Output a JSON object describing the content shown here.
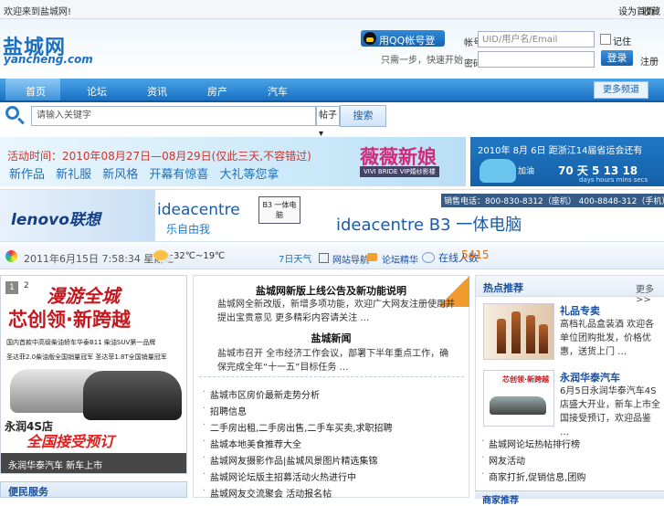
{
  "topbar": {
    "welcome": "欢迎来到盐城网!",
    "links": [
      "设为首页",
      "收藏"
    ]
  },
  "header": {
    "logo_text": "盐城网",
    "logo_sub": "yancheng.com",
    "qq_login": "用QQ帐号登录",
    "qq_note": "只需一步，快速开始",
    "uid_label": "帐号",
    "uid_placeholder": "UID/用户名/Email",
    "password_label": "密码",
    "remember_label": "记住",
    "login_button": "登录",
    "register_link": "注册"
  },
  "nav": {
    "items": [
      "首页",
      "论坛",
      "资讯",
      "房产",
      "汽车"
    ],
    "right_button": "更多频道"
  },
  "search": {
    "placeholder": "请输入关键字",
    "select_value": "帖子",
    "button": "搜索"
  },
  "banner_wedding": {
    "date_line": "活动时间：2010年08月27日—08月29日(仅此三天,不容错过)",
    "tagline": "新作品  新礼服  新风格  开幕有惊喜  大礼等您拿",
    "brand": "薇薇新娘",
    "brand_sub": "VIVI BRIDE  VIP婚纱影楼"
  },
  "banner_games": {
    "text": "2010年 8月 6日 距浙江14届省运会还有",
    "countdown": "70 天 5  13  18",
    "units": "days  hours  mins  secs",
    "cheer": "加油"
  },
  "banner_lenovo": {
    "logo": "lenovo联想",
    "ideacentre_1": "ideacentre",
    "ideacentre_sub": "乐自由我",
    "b3_box": "B3 一体电脑",
    "ideacentre_2": "ideacentre B3 一体电脑",
    "sales": "销售电话：800-830-8312（座机） 400-8848-312（手机）"
  },
  "infobar": {
    "datetime": "2011年6月15日 7:58:34 星期三",
    "weather": "32℃~19℃",
    "link_a": "7日天气",
    "link_b": "网站导航",
    "link_c": "论坛精华",
    "online_label": "在线人数",
    "online_count": "5415"
  },
  "slideshow": {
    "page_current": "1",
    "page_next": "2",
    "ad_title": "漫游全城",
    "ad_slogan": "芯创领·新跨越",
    "ad_line1": "国内首款中高级柴油轿车华泰B11  柴油SUV第一品牌",
    "ad_line2": "圣达菲2.0柴油版全国销量冠军  圣达菲1.8T全国销量冠军",
    "ad_shop": "永润4S店",
    "ad_call": "全国接受预订",
    "caption": "永润华泰汽车 新车上市"
  },
  "left_bottom_title": "便民服务",
  "middle": {
    "headline1": "盐城网新版上线公告及新功能说明",
    "para1": "盐城网全新改版，新增多项功能，欢迎广大网友注册使用并提出宝贵意见 更多精彩内容请关注 …",
    "headline2": "盐城新闻",
    "para2": "盐城市召开 全市经济工作会议，部署下半年重点工作，确保完成全年“十一五”目标任务 …",
    "list": [
      "盐城市区房价最新走势分析",
      "招聘信息",
      "二手房出租,二手房出售,二手车买卖,求职招聘",
      "盐城本地美食推荐大全",
      "盐城网友摄影作品|盐城风景图片精选集锦",
      "盐城网论坛版主招募活动火热进行中",
      "盐城网友交流聚会 活动报名帖"
    ]
  },
  "right": {
    "title": "热点推荐",
    "more": "更多>>",
    "items": [
      {
        "title": "礼品专卖",
        "desc": "高档礼品盒装酒 欢迎各单位团购批发，价格优惠，送货上门 …"
      },
      {
        "title": "永润华泰汽车",
        "desc": "6月5日永润华泰汽车4S店盛大开业，新车上市全国接受预订，欢迎品鉴 …"
      }
    ],
    "list": [
      "盐城网论坛热帖排行榜",
      "网友活动",
      "商家打折,促销信息,团购"
    ],
    "bottom_title": "商家推荐"
  }
}
